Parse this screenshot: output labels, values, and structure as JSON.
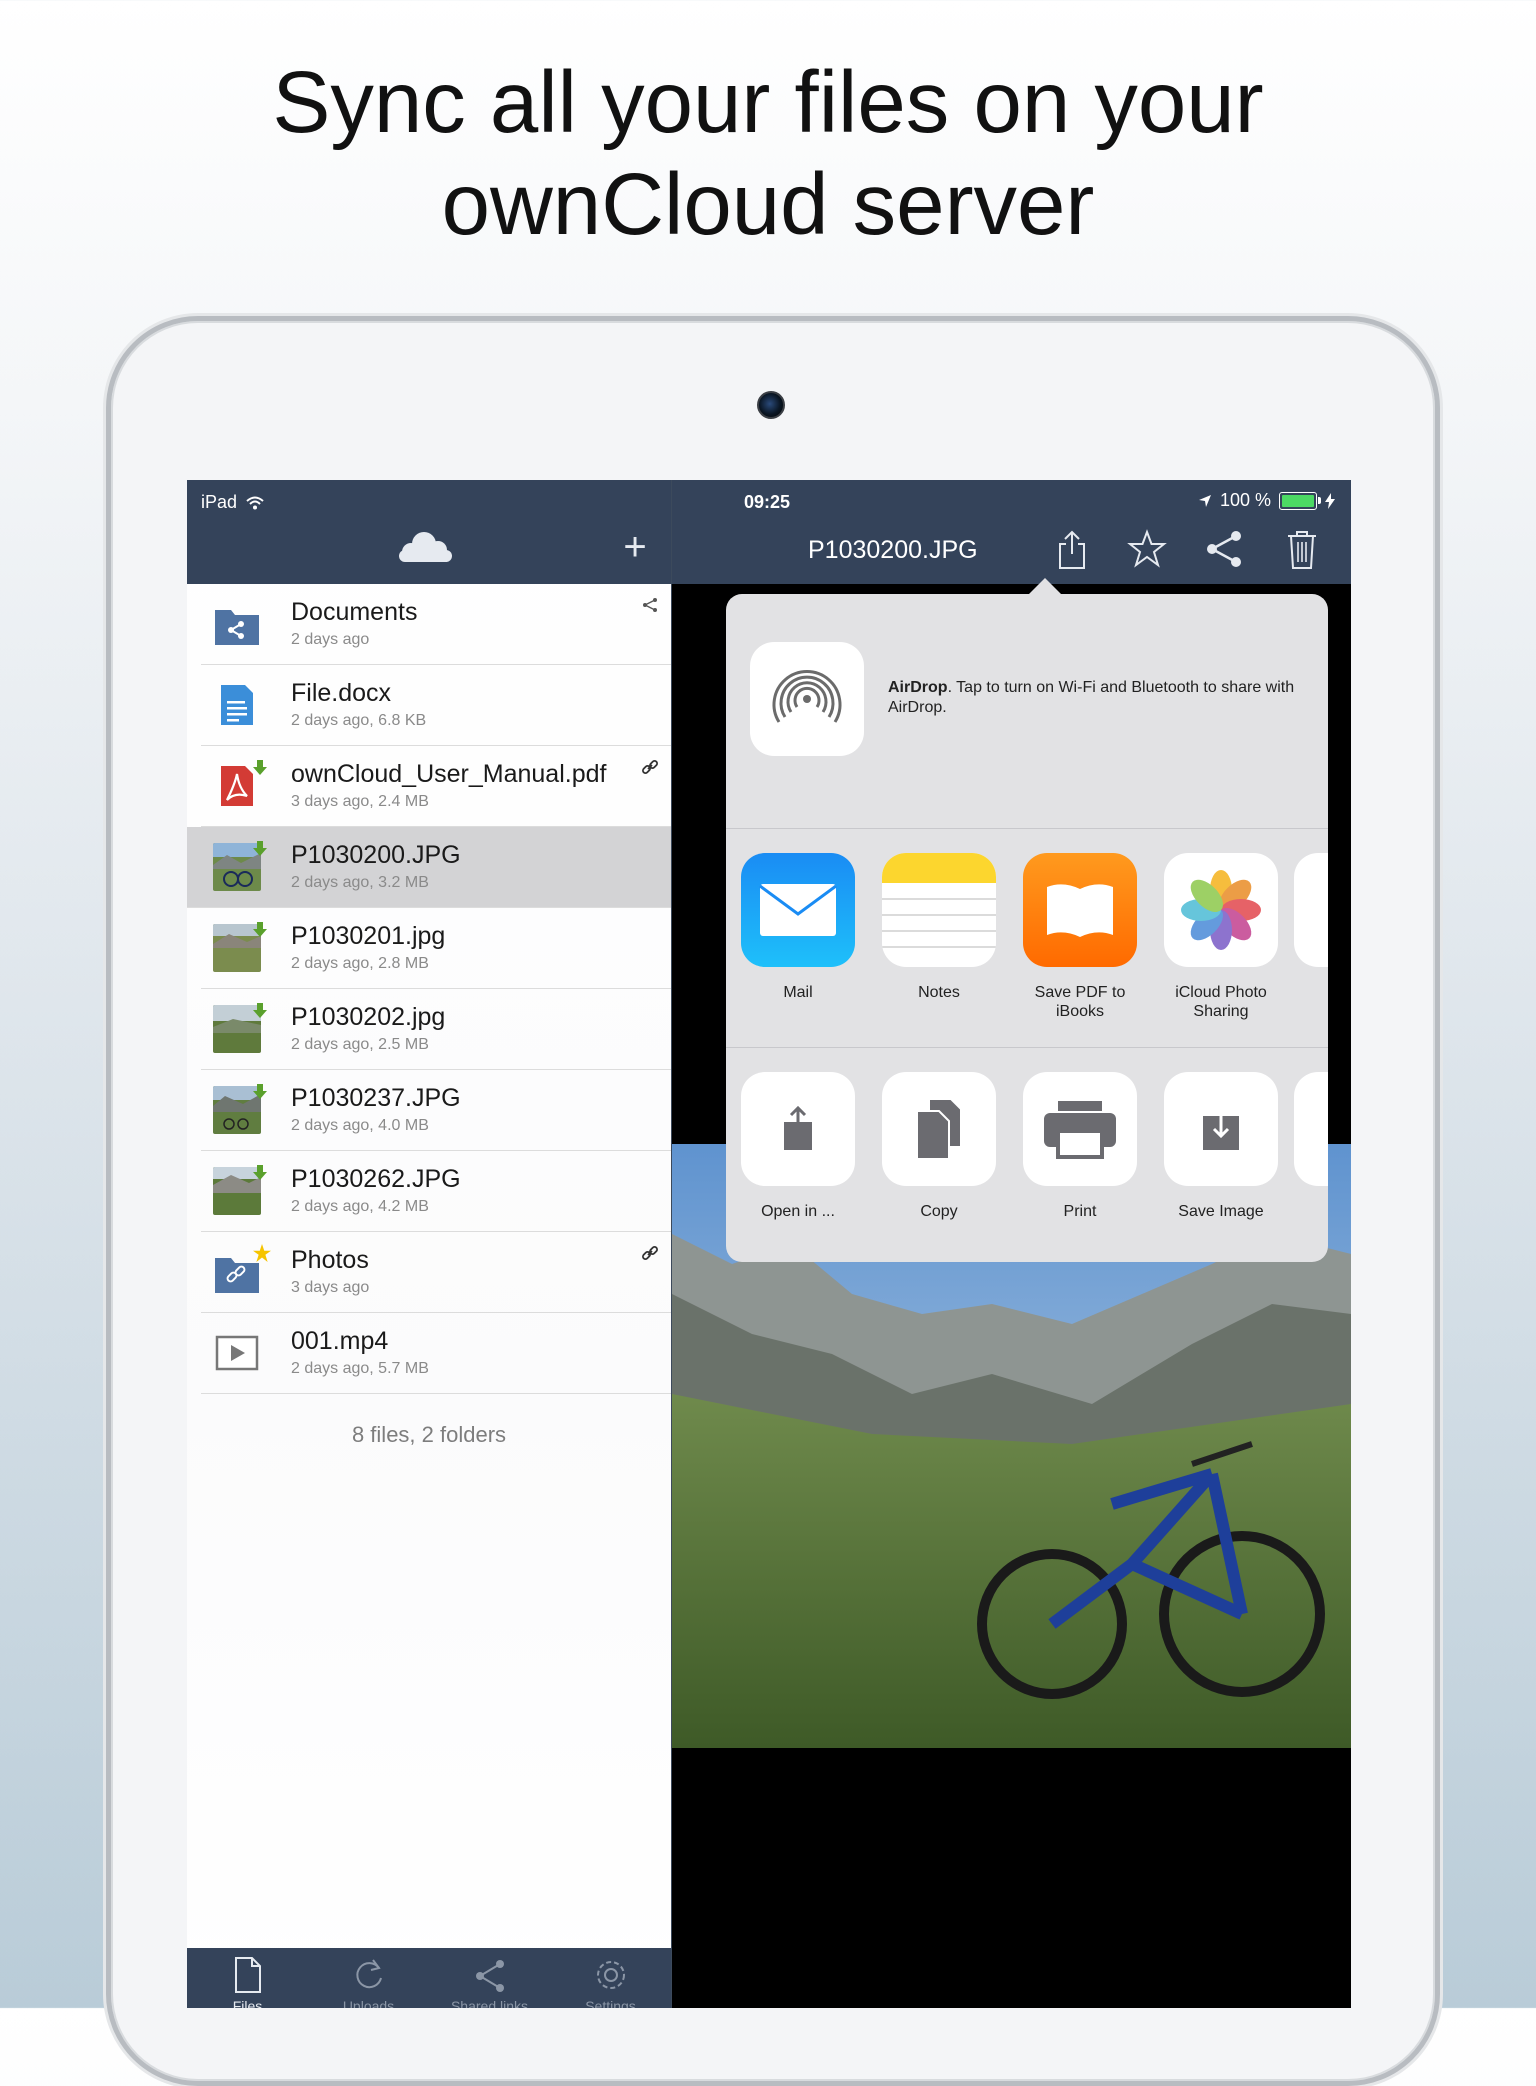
{
  "headline": {
    "line1": "Sync all your files on your",
    "line2": "ownCloud server"
  },
  "status_bar": {
    "device": "iPad",
    "time": "09:25",
    "battery": "100 %"
  },
  "left_header": {
    "add_label": "+"
  },
  "files": [
    {
      "name": "Documents",
      "meta": "2 days ago",
      "type": "shared-folder",
      "badge": "share-icon"
    },
    {
      "name": "File.docx",
      "meta": "2 days ago, 6.8 KB",
      "type": "document"
    },
    {
      "name": "ownCloud_User_Manual.pdf",
      "meta": "3 days ago, 2.4 MB",
      "type": "pdf",
      "badge": "link-icon"
    },
    {
      "name": "P1030200.JPG",
      "meta": "2 days ago, 3.2 MB",
      "type": "image",
      "selected": true
    },
    {
      "name": "P1030201.jpg",
      "meta": "2 days ago, 2.8 MB",
      "type": "image"
    },
    {
      "name": "P1030202.jpg",
      "meta": "2 days ago, 2.5 MB",
      "type": "image"
    },
    {
      "name": "P1030237.JPG",
      "meta": "2 days ago, 4.0 MB",
      "type": "image"
    },
    {
      "name": "P1030262.JPG",
      "meta": "2 days ago, 4.2 MB",
      "type": "image"
    },
    {
      "name": "Photos",
      "meta": "3 days ago",
      "type": "linked-folder",
      "badge": "link-icon"
    },
    {
      "name": "001.mp4",
      "meta": "2 days ago, 5.7 MB",
      "type": "video"
    }
  ],
  "list_summary": "8 files, 2 folders",
  "tabs": [
    {
      "label": "Files"
    },
    {
      "label": "Uploads"
    },
    {
      "label": "Shared links"
    },
    {
      "label": "Settings"
    }
  ],
  "viewer": {
    "title": "P1030200.JPG"
  },
  "share_sheet": {
    "airdrop_title": "AirDrop",
    "airdrop_text": ". Tap to turn on Wi-Fi and Bluetooth to share with AirDrop.",
    "apps": [
      {
        "label": "Mail"
      },
      {
        "label": "Notes"
      },
      {
        "label": "Save PDF to iBooks"
      },
      {
        "label": "iCloud Photo Sharing"
      }
    ],
    "actions": [
      {
        "label": "Open in ..."
      },
      {
        "label": "Copy"
      },
      {
        "label": "Print"
      },
      {
        "label": "Save Image"
      }
    ]
  },
  "colors": {
    "nav_bar": "#34435a",
    "folder_blue": "#4f73a3",
    "download_green": "#5aa02c",
    "pdf_red": "#d33b35",
    "favorite_yellow": "#f6c400"
  }
}
